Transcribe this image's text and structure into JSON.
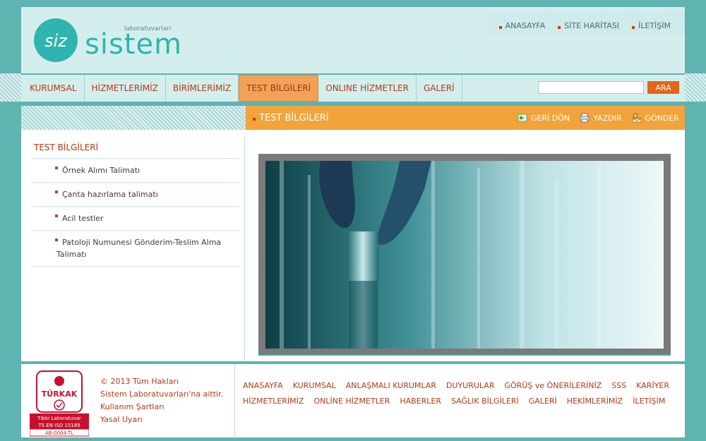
{
  "brand": {
    "name": "sistem",
    "tagline": "laboratuvarları",
    "monogram": "siz",
    "color": "#2fb5ad"
  },
  "top_links": [
    "ANASAYFA",
    "SİTE HARİTASI",
    "İLETİŞİM"
  ],
  "nav": {
    "items": [
      "KURUMSAL",
      "HİZMETLERİMİZ",
      "BİRİMLERİMİZ",
      "TEST BİLGİLERİ",
      "ONLINE HİZMETLER",
      "GALERİ"
    ],
    "active": "TEST BİLGİLERİ",
    "search_value": "",
    "search_button": "ARA"
  },
  "title_bar": {
    "title": "TEST BİLGİLERİ",
    "actions": [
      "GERİ DÖN",
      "YAZDIR",
      "GÖNDER"
    ]
  },
  "sidebar": {
    "title": "TEST BİLGİLERİ",
    "items": [
      "Örnek Alımı Talimatı",
      "Çanta hazırlama talimatı",
      "Acil testler",
      "Patoloji Numunesi Gönderim-Teslim Alma Talimatı"
    ]
  },
  "footer": {
    "cert": {
      "brand": "TÜRKAK",
      "line1": "Tıbbi Laboratuvar",
      "line2": "TS EN ISO 15189",
      "code": "AB-0004-TL"
    },
    "copyright": "© 2013 Tüm Hakları",
    "owner": "Sistem Laboratuvarları'na aittir.",
    "terms": "Kullanım Şartları",
    "legal": "Yasal Uyarı",
    "links_row1": [
      "ANASAYFA",
      "KURUMSAL",
      "ANLAŞMALI KURUMLAR",
      "DUYURULAR",
      "GÖRÜŞ ve ÖNERİLERİNİZ",
      "SSS",
      "KARİYER"
    ],
    "links_row2": [
      "HİZMETLERİMİZ",
      "ONLİNE HİZMETLER",
      "HABERLER",
      "SAĞLIK BİLGİLERİ",
      "GALERİ",
      "HEKİMLERİMİZ",
      "İLETİŞİM"
    ]
  },
  "colors": {
    "accent": "#b33a14",
    "orange": "#f2a33a",
    "teal": "#5fb3b0"
  }
}
